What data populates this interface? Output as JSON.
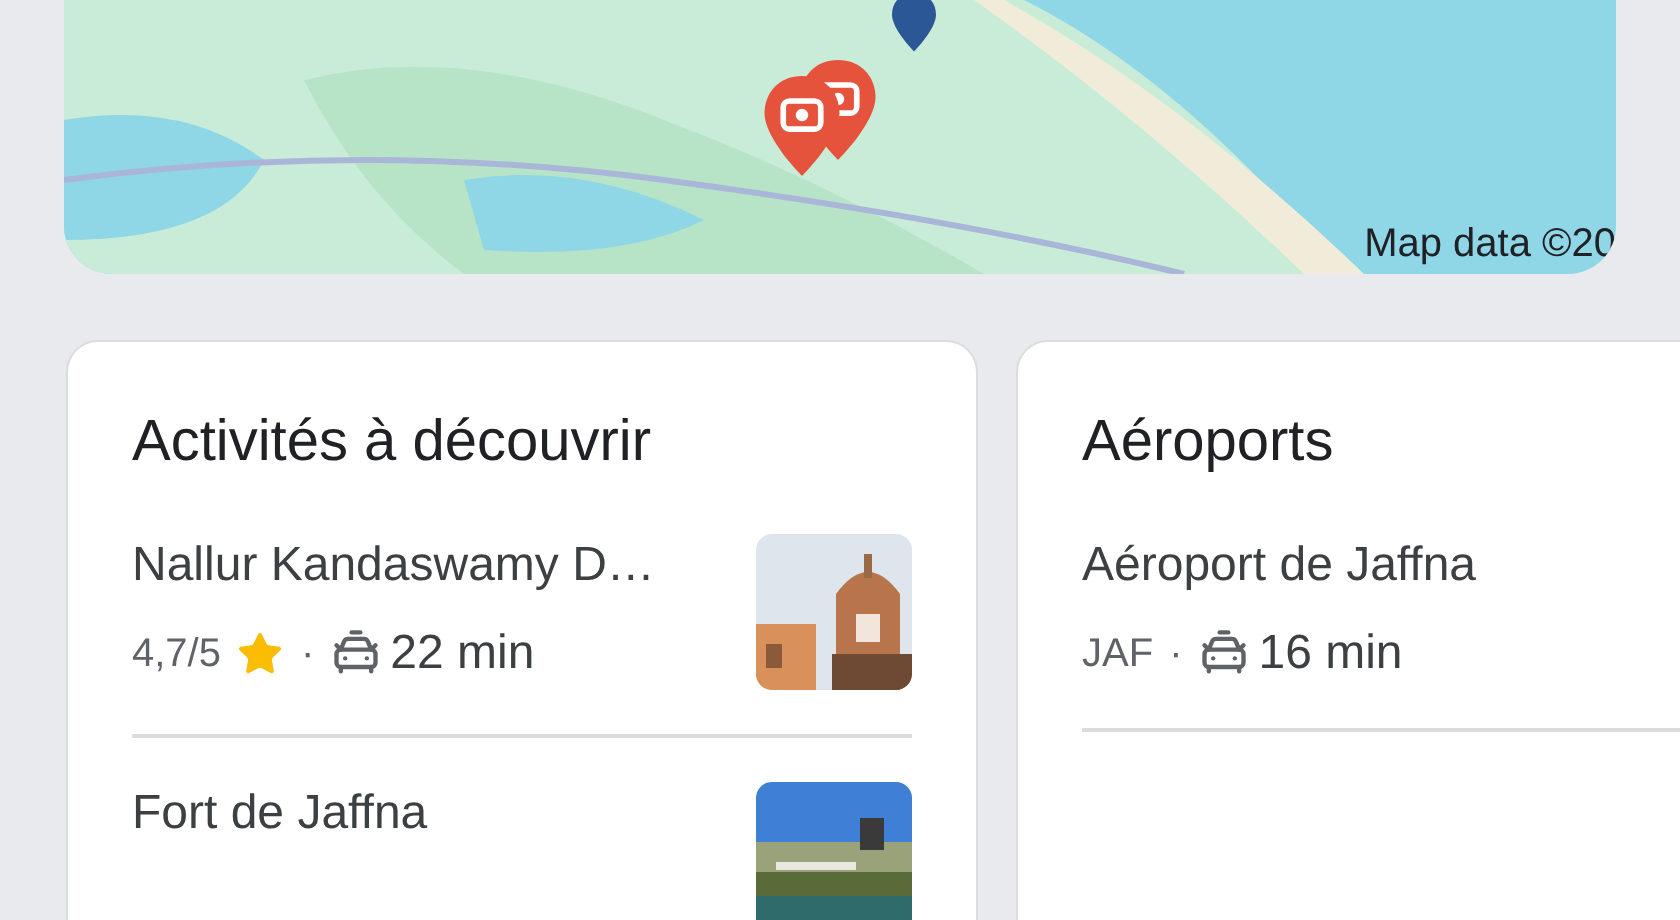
{
  "map": {
    "kind": "picture",
    "attribution": "Map data ©20"
  },
  "cards": [
    {
      "title": "Activités à découvrir",
      "items": [
        {
          "name": "Nallur Kandaswamy D…",
          "rating": "4,7/5",
          "separator": "·",
          "duration": "22 min"
        },
        {
          "name": "Fort de Jaffna"
        }
      ]
    },
    {
      "title": "Aéroports",
      "items": [
        {
          "name": "Aéroport de Jaffna",
          "code": "JAF",
          "separator": "·",
          "duration": "16 min"
        }
      ]
    }
  ]
}
